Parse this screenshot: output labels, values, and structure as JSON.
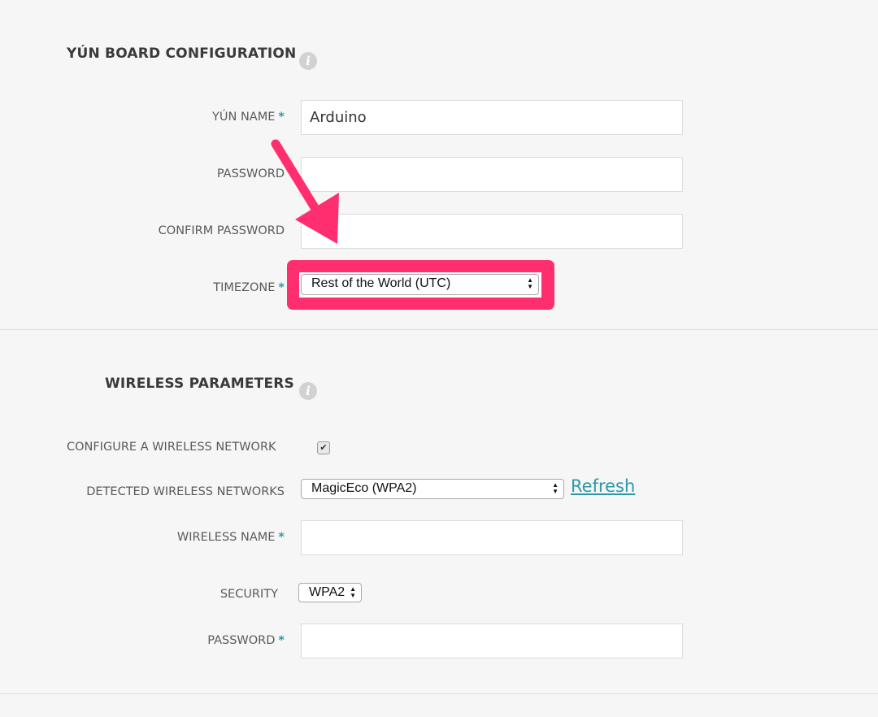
{
  "board": {
    "heading": "YÚN BOARD CONFIGURATION",
    "name_label": "YÚN NAME",
    "name_value": "Arduino",
    "password_label": "PASSWORD",
    "confirm_label": "CONFIRM PASSWORD",
    "timezone_label": "TIMEZONE",
    "timezone_value": "Rest of the World (UTC)",
    "required": "*"
  },
  "wireless": {
    "heading": "WIRELESS PARAMETERS",
    "configure_label": "CONFIGURE A WIRELESS NETWORK",
    "configure_checked": true,
    "detected_label": "DETECTED WIRELESS NETWORKS",
    "detected_value": "MagicEco (WPA2)",
    "refresh_label": "Refresh",
    "name_label": "WIRELESS NAME",
    "security_label": "SECURITY",
    "security_value": "WPA2",
    "password_label": "PASSWORD",
    "required": "*"
  },
  "colors": {
    "accent": "#2a9aa8",
    "highlight": "#ff2e6e"
  }
}
